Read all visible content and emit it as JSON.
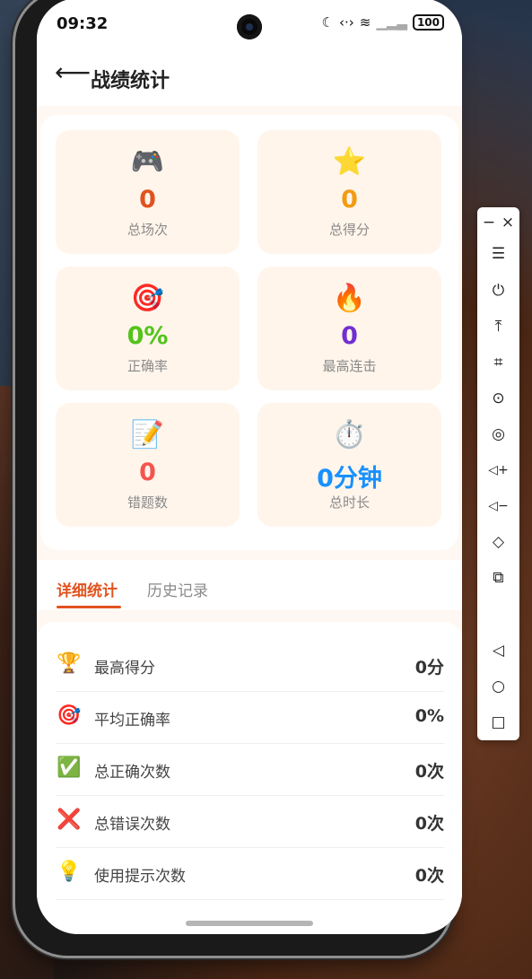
{
  "status_bar": {
    "time": "09:32",
    "icons": [
      "moon-icon",
      "data-transfer-icon",
      "wifi-icon",
      "no-signal-icon"
    ],
    "battery": "100"
  },
  "app_bar": {
    "back_icon": "arrow-left-icon",
    "title": "战绩统计"
  },
  "stats": [
    {
      "icon": "🎮",
      "icon_name": "gamepad-icon",
      "value": "0",
      "label": "总场次",
      "color": "#e0531e"
    },
    {
      "icon": "⭐",
      "icon_name": "star-icon",
      "value": "0",
      "label": "总得分",
      "color": "#f39c12"
    },
    {
      "icon": "🎯",
      "icon_name": "target-icon",
      "value": "0%",
      "label": "正确率",
      "color": "#52c41a"
    },
    {
      "icon": "🔥",
      "icon_name": "fire-icon",
      "value": "0",
      "label": "最高连击",
      "color": "#722ed1"
    },
    {
      "icon": "📝",
      "icon_name": "memo-icon",
      "value": "0",
      "label": "错题数",
      "color": "#f5544e"
    },
    {
      "icon": "⏱️",
      "icon_name": "stopwatch-icon",
      "value": "0分钟",
      "label": "总时长",
      "color": "#1890ff"
    }
  ],
  "tabs": [
    {
      "label": "详细统计",
      "active": true
    },
    {
      "label": "历史记录",
      "active": false
    }
  ],
  "details": [
    {
      "icon": "🏆",
      "icon_name": "trophy-icon",
      "label": "最高得分",
      "value": "0分"
    },
    {
      "icon": "🎯",
      "icon_name": "target-icon",
      "label": "平均正确率",
      "value": "0%"
    },
    {
      "icon": "✅",
      "icon_name": "check-icon",
      "label": "总正确次数",
      "value": "0次"
    },
    {
      "icon": "❌",
      "icon_name": "cross-icon",
      "label": "总错误次数",
      "value": "0次"
    },
    {
      "icon": "💡",
      "icon_name": "lightbulb-icon",
      "label": "使用提示次数",
      "value": "0次"
    }
  ],
  "side_panel": {
    "buttons": [
      {
        "glyph": "☰",
        "name": "menu-icon"
      },
      {
        "glyph": "⏻",
        "name": "power-icon"
      },
      {
        "glyph": "⤒",
        "name": "top-icon"
      },
      {
        "glyph": "⌗",
        "name": "crop-icon"
      },
      {
        "glyph": "⊙",
        "name": "rotate-icon"
      },
      {
        "glyph": "◎",
        "name": "rotate-alt-icon"
      },
      {
        "glyph": "◁+",
        "name": "volume-up-icon"
      },
      {
        "glyph": "◁−",
        "name": "volume-down-icon"
      },
      {
        "glyph": "◇",
        "name": "shake-icon"
      },
      {
        "glyph": "⧉",
        "name": "multi-device-icon"
      },
      {
        "glyph": "◁",
        "name": "nav-back-icon"
      },
      {
        "glyph": "○",
        "name": "nav-home-icon"
      },
      {
        "glyph": "□",
        "name": "nav-recent-icon"
      }
    ]
  }
}
